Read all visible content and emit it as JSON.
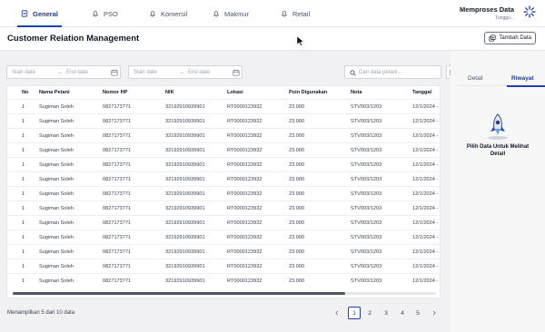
{
  "tabs": [
    {
      "label": "General",
      "icon": "document-icon",
      "active": true
    },
    {
      "label": "PSO",
      "icon": "bell-icon",
      "active": false
    },
    {
      "label": "Komersil",
      "icon": "bell-icon",
      "active": false
    },
    {
      "label": "Makmur",
      "icon": "bell-icon",
      "active": false
    },
    {
      "label": "Retail",
      "icon": "bell-icon",
      "active": false
    }
  ],
  "processing": {
    "title": "Memproses Data",
    "subtitle": "Tunggu..."
  },
  "page": {
    "title": "Customer Relation Management",
    "add_button": "Tambah Data"
  },
  "filters": {
    "range1": {
      "start": "Start date",
      "end": "End date"
    },
    "range2": {
      "start": "Start date",
      "end": "End date"
    },
    "search_placeholder": "Cari data petani..."
  },
  "table": {
    "columns": [
      "No",
      "Nama Petani",
      "Nomor HP",
      "NIK",
      "Lokasi",
      "Poin Digunakan",
      "Nota",
      "Tanggal"
    ],
    "rows": [
      [
        "1",
        "Sugiman Soleh",
        "0827173771",
        "32192910939901",
        "RT0000123932",
        "23.000",
        "STV003/1203",
        "12/1/2024 -"
      ],
      [
        "1",
        "Sugiman Soleh",
        "0827173771",
        "32192910939901",
        "RT0000123932",
        "23.000",
        "STV003/1203",
        "12/1/2024 -"
      ],
      [
        "1",
        "Sugiman Soleh",
        "0827173771",
        "32192910939901",
        "RT0000123932",
        "23.000",
        "STV003/1203",
        "12/1/2024 -"
      ],
      [
        "1",
        "Sugiman Soleh",
        "0827173771",
        "32192910939901",
        "RT0000123932",
        "23.000",
        "STV003/1203",
        "12/1/2024 -"
      ],
      [
        "1",
        "Sugiman Soleh",
        "0827173771",
        "32192910939901",
        "RT0000123932",
        "23.000",
        "STV003/1203",
        "12/1/2024 -"
      ],
      [
        "1",
        "Sugiman Soleh",
        "0827173771",
        "32192910939901",
        "RT0000123932",
        "23.000",
        "STV003/1203",
        "12/1/2024 -"
      ],
      [
        "1",
        "Sugiman Soleh",
        "0827173771",
        "32192910939901",
        "RT0000123932",
        "23.000",
        "STV003/1203",
        "12/1/2024 -"
      ],
      [
        "1",
        "Sugiman Soleh",
        "0827173771",
        "32192910939901",
        "RT0000123932",
        "23.000",
        "STV003/1203",
        "12/1/2024 -"
      ],
      [
        "1",
        "Sugiman Soleh",
        "0827173771",
        "32192910939901",
        "RT0000123932",
        "23.000",
        "STV003/1203",
        "12/1/2024 -"
      ],
      [
        "1",
        "Sugiman Soleh",
        "0827173771",
        "32192910939901",
        "RT0000123932",
        "23.000",
        "STV003/1203",
        "12/1/2024 -"
      ],
      [
        "1",
        "Sugiman Soleh",
        "0827173771",
        "32192910939901",
        "RT0000123932",
        "23.000",
        "STV003/1203",
        "12/1/2024 -"
      ],
      [
        "1",
        "Sugiman Soleh",
        "0827173771",
        "32192910939901",
        "RT0000123932",
        "23.000",
        "STV003/1203",
        "12/1/2024 -"
      ],
      [
        "1",
        "Sugiman Soleh",
        "0827173771",
        "32192910939901",
        "RT0000123932",
        "23.000",
        "STV003/1203",
        "12/1/2024 -"
      ]
    ]
  },
  "footer": {
    "summary": "Menampilkan 5 dari 10 data",
    "pages": [
      "1",
      "2",
      "3",
      "4",
      "5"
    ],
    "current_page": "1"
  },
  "right_panel": {
    "tabs": [
      "Detail",
      "Riwayat"
    ],
    "active_tab": "Riwayat",
    "empty_message": "Pilih Data Untuk Melihat Detail"
  },
  "colors": {
    "accent": "#1e40af",
    "background": "#f1f1f3",
    "panel": "#f7f7f8"
  }
}
